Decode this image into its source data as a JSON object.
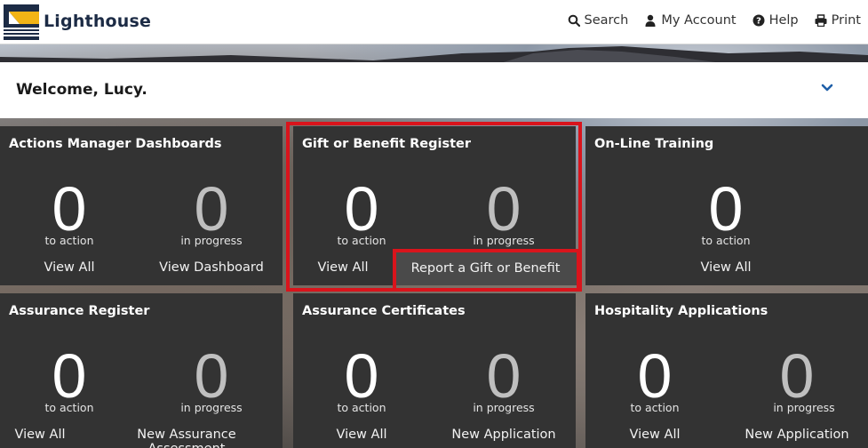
{
  "header": {
    "brand": "Lighthouse",
    "nav": [
      {
        "label": "Search",
        "icon": "search-icon"
      },
      {
        "label": "My Account",
        "icon": "user-icon"
      },
      {
        "label": "Help",
        "icon": "help-icon"
      },
      {
        "label": "Print",
        "icon": "print-icon"
      }
    ]
  },
  "welcome": {
    "text": "Welcome, Lucy.",
    "toggle_icon": "chevron-down-icon"
  },
  "tiles": [
    {
      "title": "Actions Manager Dashboards",
      "left_count": "0",
      "left_label": "to action",
      "right_count": "0",
      "right_label": "in progress",
      "left_link": "View All",
      "right_link": "View Dashboard"
    },
    {
      "title": "Gift or Benefit Register",
      "left_count": "0",
      "left_label": "to action",
      "right_count": "0",
      "right_label": "in progress",
      "left_link": "View All",
      "right_link": "Report a Gift or Benefit"
    },
    {
      "title": "On-Line Training",
      "left_count": "0",
      "left_label": "to action",
      "left_link": "View All"
    },
    {
      "title": "Assurance Register",
      "left_count": "0",
      "left_label": "to action",
      "right_count": "0",
      "right_label": "in progress",
      "left_link": "View All",
      "right_link": "New Assurance Assessment"
    },
    {
      "title": "Assurance Certificates",
      "left_count": "0",
      "left_label": "to action",
      "right_count": "0",
      "right_label": "in progress",
      "left_link": "View All",
      "right_link": "New Application"
    },
    {
      "title": "Hospitality Applications",
      "left_count": "0",
      "left_label": "to action",
      "right_count": "0",
      "right_label": "in progress",
      "left_link": "View All",
      "right_link": "New Application"
    }
  ],
  "colors": {
    "highlight": "#d9141c",
    "tile_bg": "#333333",
    "brand_navy": "#1c2b45",
    "brand_gold": "#f2b416"
  }
}
